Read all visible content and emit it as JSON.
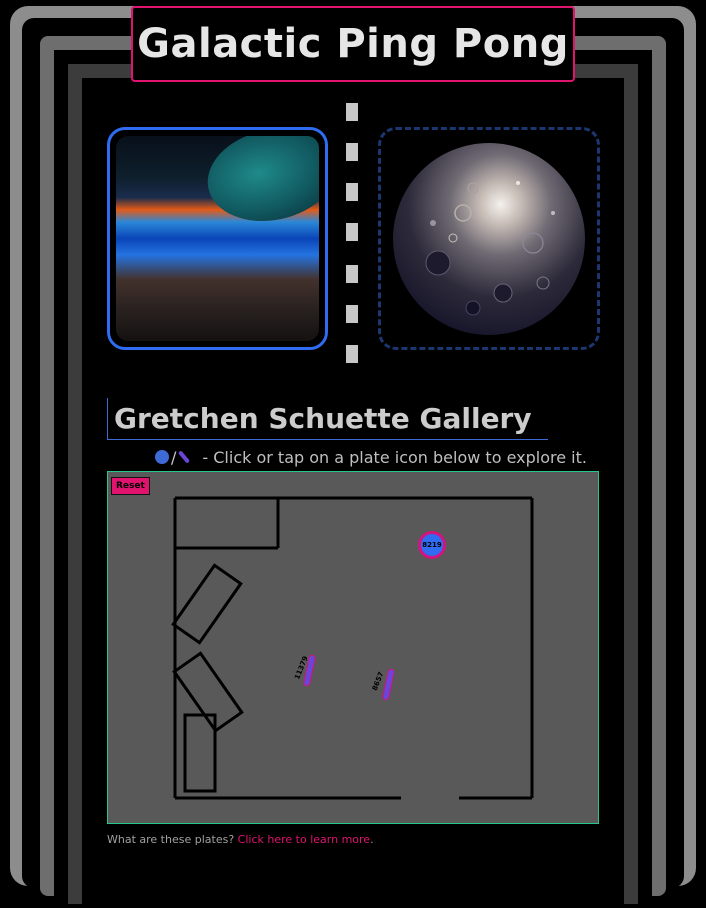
{
  "page": {
    "title": "Galactic Ping Pong",
    "accent_color": "#e0136f",
    "frame_colors": [
      "#8d8d8d",
      "#6e6e6e",
      "#3c3c3c"
    ]
  },
  "images": {
    "left": {
      "icon": "cosmic-landscape-image",
      "border_color": "#2f6cf2"
    },
    "right": {
      "icon": "cosmic-orb-image",
      "border_color": "#1c3670"
    }
  },
  "gallery": {
    "heading": "Gretchen Schuette Gallery",
    "instruction": "- Click or tap on a plate icon below to explore it.",
    "instruction_icons": [
      "plate-circle-icon",
      "plate-oval-icon"
    ]
  },
  "map": {
    "reset_label": "Reset",
    "plates": [
      {
        "id": "8219",
        "shape": "circle"
      },
      {
        "id": "11379",
        "shape": "oval"
      },
      {
        "id": "8657",
        "shape": "oval"
      }
    ]
  },
  "footer": {
    "question": "What are these plates?",
    "link_text": "Click here to learn more",
    "period": "."
  }
}
